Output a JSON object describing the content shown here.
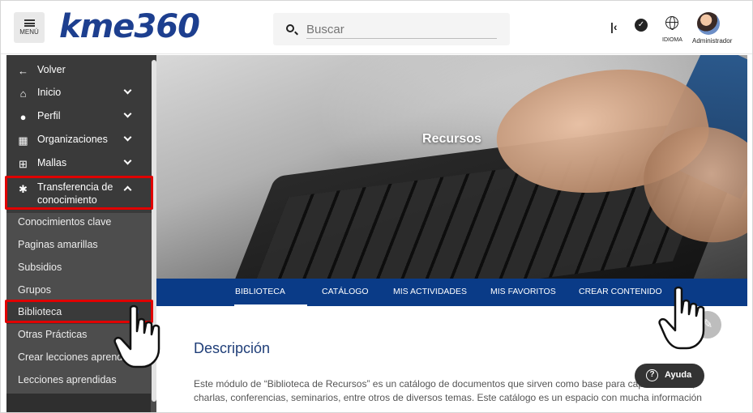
{
  "header": {
    "menu_label": "MENÚ",
    "logo": "kme360",
    "search_placeholder": "Buscar",
    "language_label": "IDIOMA",
    "user_name": "Administrador"
  },
  "sidebar": {
    "back_label": "Volver",
    "items": [
      {
        "label": "Inicio",
        "icon": "home-icon"
      },
      {
        "label": "Perfil",
        "icon": "user-circle-icon"
      },
      {
        "label": "Organizaciones",
        "icon": "building-icon"
      },
      {
        "label": "Mallas",
        "icon": "grid-icon"
      }
    ],
    "expanded_item": {
      "line1": "Transferencia de",
      "line2": "conocimiento",
      "icon": "puzzle-icon"
    },
    "subitems": [
      "Conocimientos clave",
      "Paginas amarillas",
      "Subsidios",
      "Grupos",
      "Biblioteca",
      "Otras Prácticas",
      "Crear lecciones aprendidas",
      "Lecciones aprendidas"
    ],
    "active_subitem": "Biblioteca"
  },
  "hero": {
    "title": "Recursos"
  },
  "tabs": [
    {
      "label": "BIBLIOTECA",
      "active": true
    },
    {
      "label": "CATÁLOGO",
      "active": false
    },
    {
      "label": "MIS ACTIVIDADES",
      "active": false
    },
    {
      "label": "MIS FAVORITOS",
      "active": false
    },
    {
      "label": "CREAR CONTENIDO",
      "active": false
    }
  ],
  "content": {
    "title": "Descripción",
    "text": "Este módulo de “Biblioteca de Recursos” es un catálogo de documentos que sirven como base para capacitaciones, charlas, conferencias, seminarios, entre otros de diversos temas. Este catálogo es un espacio con mucha información"
  },
  "help_button": {
    "label": "Ayuda"
  },
  "colors": {
    "brand_blue": "#0a3b87",
    "logo_blue": "#1d3f8f",
    "sidebar_bg": "#4d4d4d",
    "highlight_red": "#e00000"
  }
}
